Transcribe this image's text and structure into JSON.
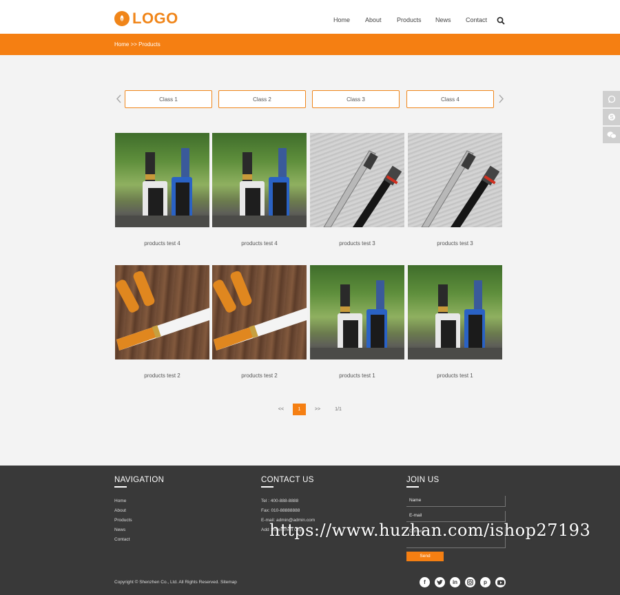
{
  "header": {
    "logo_text": "LOGO",
    "nav": [
      "Home",
      "About",
      "Products",
      "News",
      "Contact"
    ]
  },
  "breadcrumb": "Home >> Products",
  "tabs": [
    "Class 1",
    "Class 2",
    "Class 3",
    "Class 4"
  ],
  "products": [
    {
      "name": "products test 4",
      "image": "green-mod"
    },
    {
      "name": "products test 4",
      "image": "green-mod"
    },
    {
      "name": "products test 3",
      "image": "grey-pen"
    },
    {
      "name": "products test 3",
      "image": "grey-pen"
    },
    {
      "name": "products test 2",
      "image": "wood-cig"
    },
    {
      "name": "products test 2",
      "image": "wood-cig"
    },
    {
      "name": "products test 1",
      "image": "green-mod"
    },
    {
      "name": "products test 1",
      "image": "green-mod"
    }
  ],
  "pagination": {
    "prev": "<<",
    "current": "1",
    "next": ">>",
    "total": "1/1"
  },
  "footer": {
    "navigation_title": "NAVIGATION",
    "navigation_links": [
      "Home",
      "About",
      "Products",
      "News",
      "Contact"
    ],
    "contact_title": "CONTACT US",
    "contact_lines": [
      "Tel : 400-888-8888",
      "Fax: 010-88888888",
      "E-mail: admin@admin.com",
      "Add : Shenzhen City"
    ],
    "join_title": "JOIN US",
    "form": {
      "name_placeholder": "Name",
      "email_placeholder": "E-mail",
      "content_placeholder": "Content",
      "send_label": "Send"
    },
    "copyright": "Copyright © Shenzhen Co., Ltd. All Rights Reserved. Sitemap",
    "social": [
      "f",
      "t",
      "in",
      "ig",
      "p",
      "yt"
    ]
  },
  "watermark": "https://www.huzhan.com/ishop27193",
  "colors": {
    "accent": "#f57f12",
    "footer_bg": "#393939"
  }
}
